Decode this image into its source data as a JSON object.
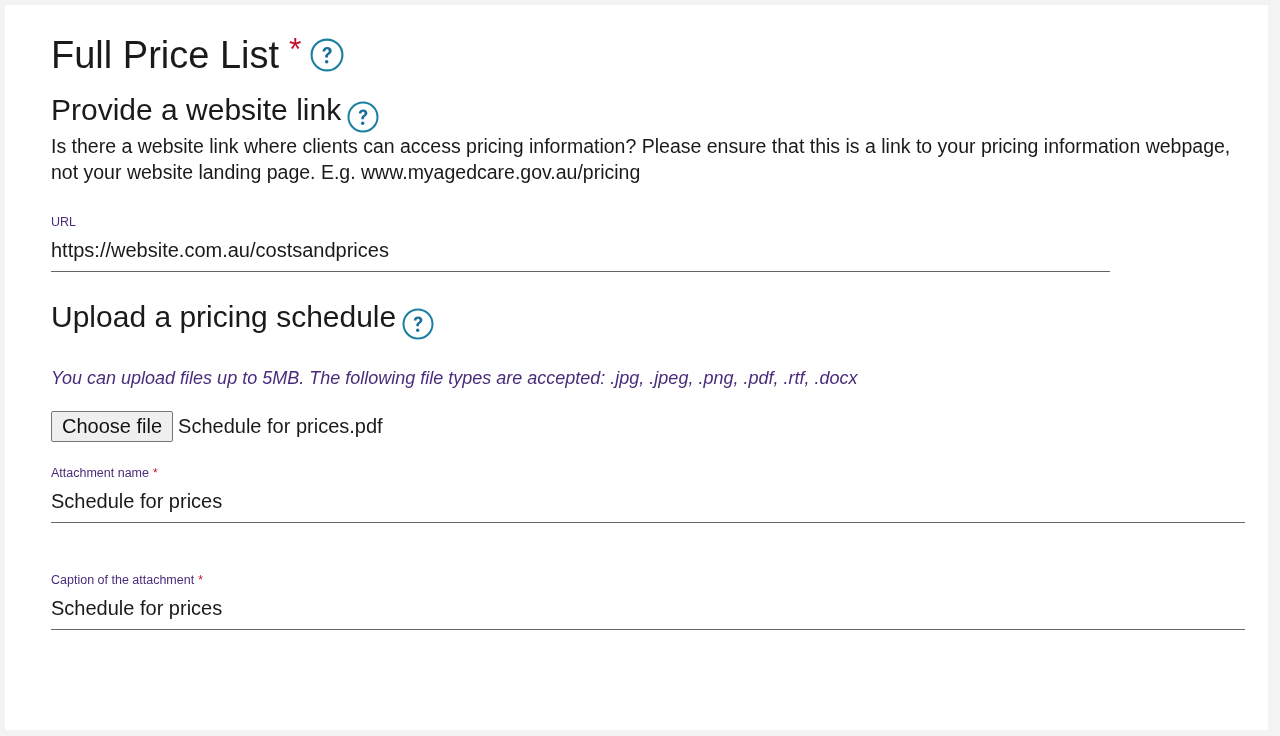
{
  "title": {
    "text": "Full Price List",
    "required_mark": "*",
    "help": true
  },
  "website_section": {
    "heading": "Provide a website link",
    "help": true,
    "description": "Is there a website link where clients can access pricing information? Please ensure that this is a link to your pricing information webpage, not your website landing page. E.g. www.myagedcare.gov.au/pricing",
    "fields": [
      {
        "label": "URL",
        "value": "https://website.com.au/costsandprices"
      }
    ]
  },
  "upload_section": {
    "heading": "Upload a pricing schedule",
    "help": true,
    "hint": "You can upload files up to 5MB. The following file types are accepted: .jpg, .jpeg, .png, .pdf, .rtf, .docx",
    "file_button": "Choose file",
    "file_name": "Schedule for prices.pdf",
    "fields": [
      {
        "label": "Attachment name",
        "value": "Schedule for prices",
        "required_mark": "*"
      },
      {
        "label": "Caption of the attachment",
        "value": "Schedule for prices",
        "required_mark": "*"
      }
    ]
  }
}
